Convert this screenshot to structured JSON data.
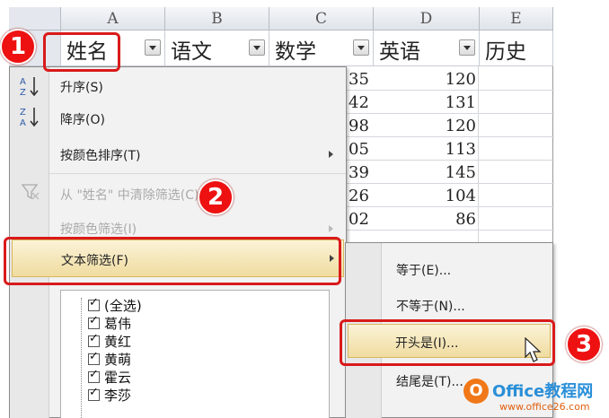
{
  "columns": [
    {
      "letter": "A",
      "header": "姓名"
    },
    {
      "letter": "B",
      "header": "语文"
    },
    {
      "letter": "C",
      "header": "数学"
    },
    {
      "letter": "D",
      "header": "英语"
    },
    {
      "letter": "E",
      "header": "历史"
    }
  ],
  "visible_cells": [
    {
      "left": "35",
      "right": "120"
    },
    {
      "left": "42",
      "right": "131"
    },
    {
      "left": "98",
      "right": "120"
    },
    {
      "left": "05",
      "right": "113"
    },
    {
      "left": "39",
      "right": "145"
    },
    {
      "left": "26",
      "right": "104"
    },
    {
      "left": "02",
      "right": "86"
    }
  ],
  "menu": {
    "sort_asc": "升序(S)",
    "sort_desc": "降序(O)",
    "sort_by_color": "按颜色排序(T)",
    "clear_filter": "从 \"姓名\" 中清除筛选(C)",
    "filter_by_color": "按颜色筛选(I)",
    "text_filter": "文本筛选(F)",
    "icons": {
      "sort_asc": "sort-az-icon",
      "sort_desc": "sort-za-icon",
      "clear_filter": "clear-filter-icon"
    }
  },
  "filter_list": [
    {
      "label": "(全选)",
      "checked": true
    },
    {
      "label": "葛伟",
      "checked": true
    },
    {
      "label": "黄红",
      "checked": true
    },
    {
      "label": "黄萌",
      "checked": true
    },
    {
      "label": "霍云",
      "checked": true
    },
    {
      "label": "李莎",
      "checked": true
    }
  ],
  "submenu": {
    "equals": "等于(E)...",
    "not_equals": "不等于(N)...",
    "begins_with": "开头是(I)...",
    "ends_with": "结尾是(T)..."
  },
  "annotations": {
    "step1": "1",
    "step2": "2",
    "step3": "3",
    "color": "#d91a1a"
  },
  "watermark": {
    "logo": "O",
    "title": "Office教程网",
    "url": "www.office26.com"
  }
}
